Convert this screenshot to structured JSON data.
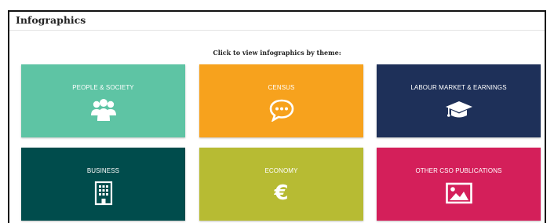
{
  "panel": {
    "title": "Infographics",
    "subtitle": "Click to view infographics by theme:"
  },
  "tiles": [
    {
      "label": "PEOPLE & SOCIETY",
      "icon": "people-group-icon",
      "color": "#5ec4a4"
    },
    {
      "label": "CENSUS",
      "icon": "speech-bubble-icon",
      "color": "#f7a21d"
    },
    {
      "label": "LABOUR MARKET & EARNINGS",
      "icon": "graduation-cap-icon",
      "color": "#1e3059"
    },
    {
      "label": "BUSINESS",
      "icon": "office-building-icon",
      "color": "#004c4c"
    },
    {
      "label": "ECONOMY",
      "icon": "euro-icon",
      "icon_text": "€",
      "color": "#b7bb33"
    },
    {
      "label": "OTHER CSO PUBLICATIONS",
      "icon": "image-icon",
      "color": "#d41f5a"
    }
  ]
}
